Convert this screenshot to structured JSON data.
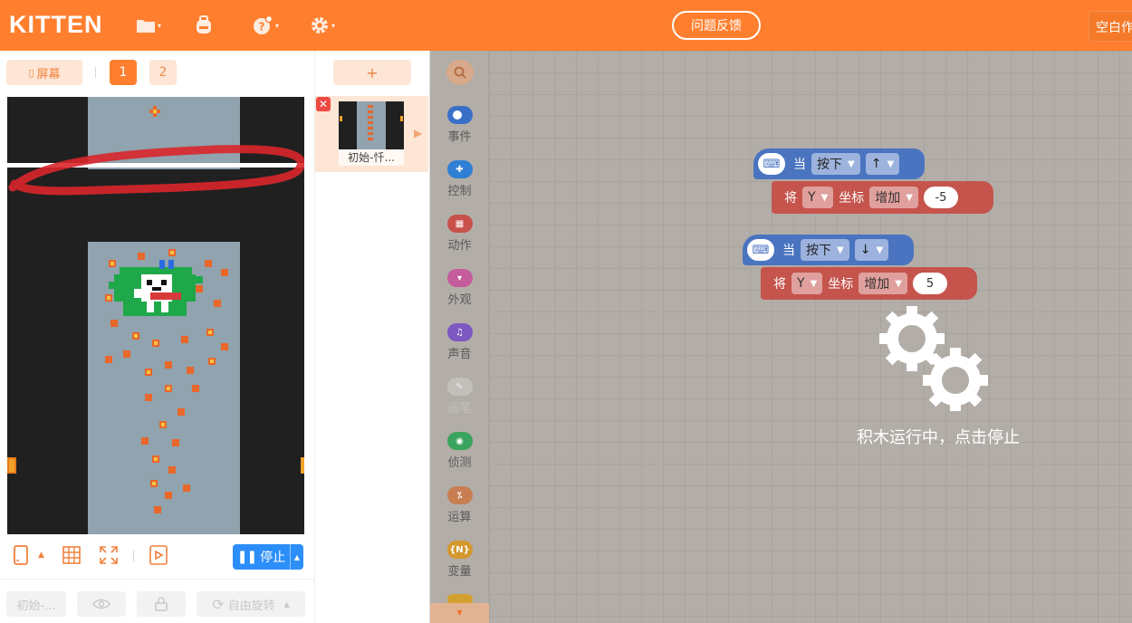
{
  "app": {
    "logo": "KITTEN",
    "feedback_label": "问题反馈",
    "right_button_label": "空白作",
    "brand_color": "#ff7f2e"
  },
  "toolbar_icons": [
    "folder-icon",
    "backpack-icon",
    "help-icon",
    "settings-icon"
  ],
  "stage_panel": {
    "screen_label": "屏幕",
    "pages": [
      "1",
      "2"
    ],
    "active_page": "1",
    "stop_label": "停止",
    "props": {
      "sprite_name": "初始-...",
      "rotate_label": "自由旋转"
    }
  },
  "sprites": {
    "add_label": "+",
    "items": [
      {
        "name": "初始-忏..."
      }
    ]
  },
  "palette": {
    "categories": [
      {
        "label": "事件",
        "color": "#3a6fc7",
        "icon": "toggle-icon"
      },
      {
        "label": "控制",
        "color": "#2f7fd4",
        "icon": "gamepad-icon"
      },
      {
        "label": "动作",
        "color": "#c9514b",
        "icon": "robot-icon"
      },
      {
        "label": "外观",
        "color": "#c45b9a",
        "icon": "shirt-icon"
      },
      {
        "label": "声音",
        "color": "#7e58c1",
        "icon": "music-icon"
      },
      {
        "label": "画笔",
        "color": "#c9c5c1",
        "icon": "brush-icon"
      },
      {
        "label": "侦测",
        "color": "#3aa35d",
        "icon": "radar-icon"
      },
      {
        "label": "运算",
        "color": "#c77f52",
        "icon": "calc-icon"
      },
      {
        "label": "变量",
        "color": "#d4982f",
        "icon": "variable-icon"
      }
    ]
  },
  "workspace": {
    "scripts": [
      {
        "hat": {
          "when": "当",
          "event": "按下",
          "key": "↑"
        },
        "action": {
          "set": "将",
          "axis": "Y",
          "coord": "坐标",
          "op": "增加",
          "value": "-5"
        }
      },
      {
        "hat": {
          "when": "当",
          "event": "按下",
          "key": "↓"
        },
        "action": {
          "set": "将",
          "axis": "Y",
          "coord": "坐标",
          "op": "增加",
          "value": "5"
        }
      }
    ],
    "running_message": "积木运行中，点击停止"
  }
}
